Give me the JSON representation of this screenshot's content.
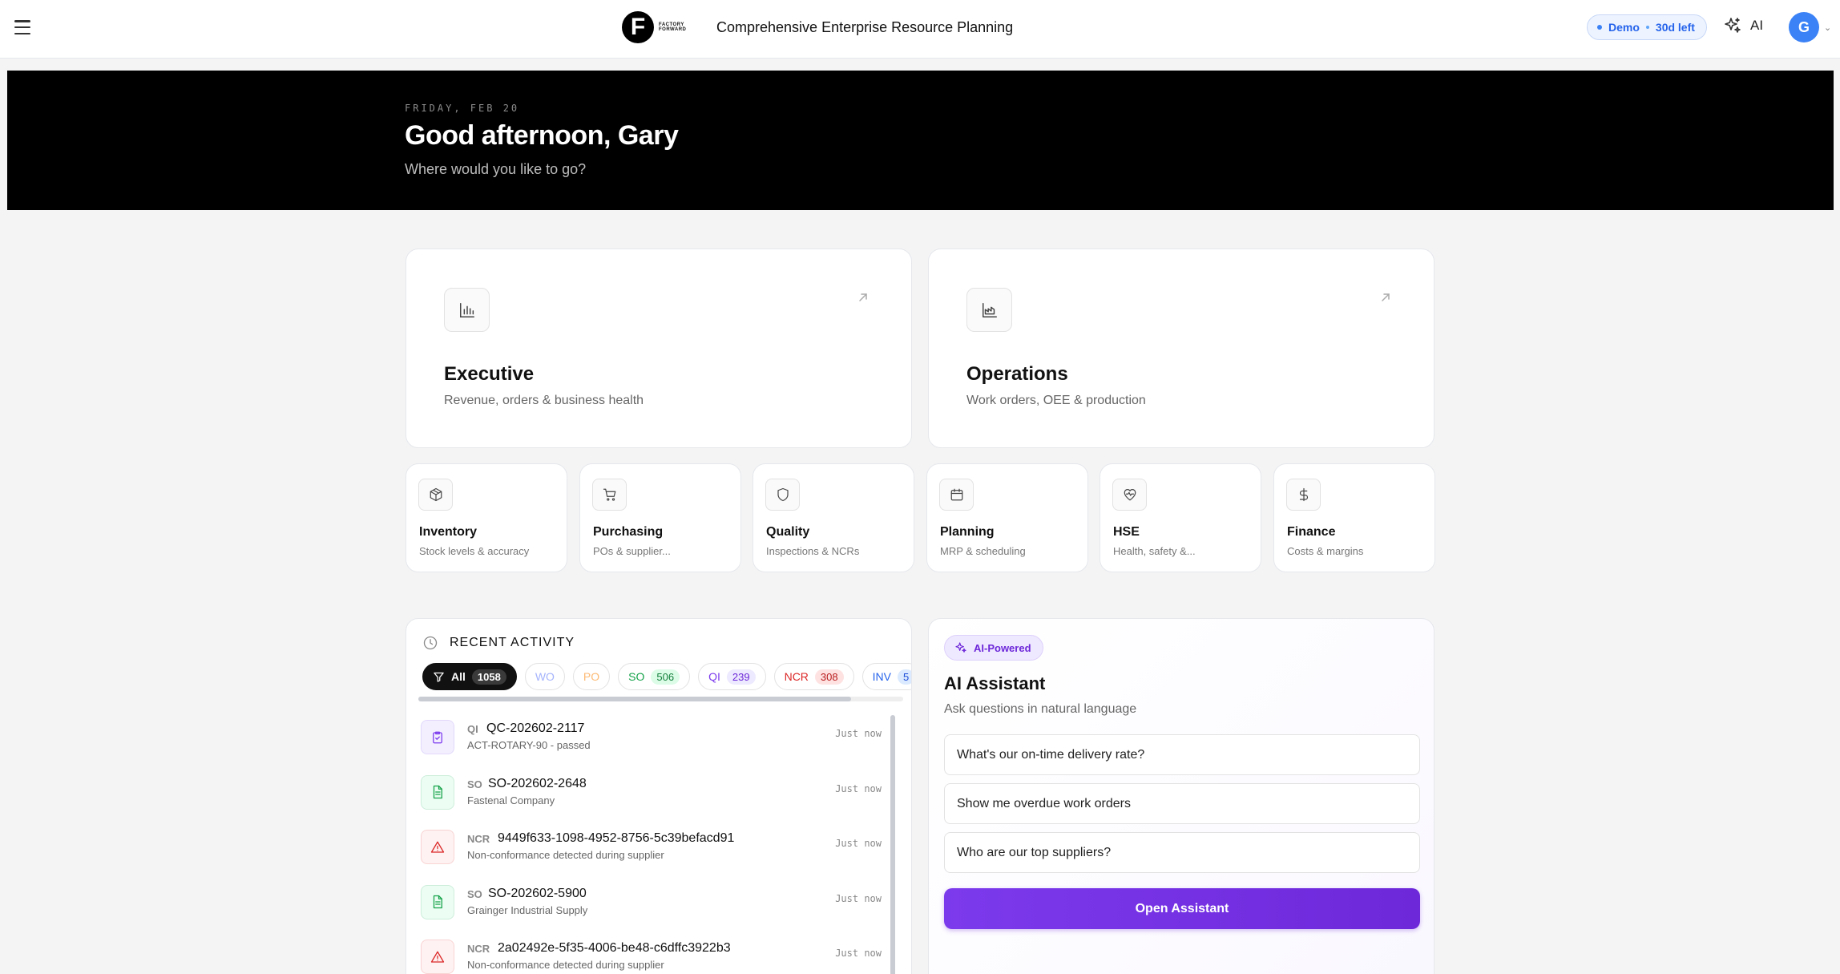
{
  "header": {
    "brand_mark": "F",
    "brand_wordmark": "FACTORY FORWARD",
    "app_title": "Comprehensive Enterprise Resource Planning",
    "demo_label": "Demo",
    "demo_remaining": "30d left",
    "ai_label": "AI",
    "avatar_initial": "G"
  },
  "hero": {
    "date": "FRIDAY, FEB 20",
    "greeting": "Good afternoon, Gary",
    "subtitle": "Where would you like to go?"
  },
  "dashboards": [
    {
      "title": "Executive",
      "desc": "Revenue, orders & business health",
      "icon": "bar-chart-icon"
    },
    {
      "title": "Operations",
      "desc": "Work orders, OEE & production",
      "icon": "factory-icon"
    }
  ],
  "modules": [
    {
      "title": "Inventory",
      "desc": "Stock levels & accuracy",
      "icon": "package-icon"
    },
    {
      "title": "Purchasing",
      "desc": "POs & supplier...",
      "icon": "cart-icon"
    },
    {
      "title": "Quality",
      "desc": "Inspections & NCRs",
      "icon": "shield-icon"
    },
    {
      "title": "Planning",
      "desc": "MRP & scheduling",
      "icon": "calendar-icon"
    },
    {
      "title": "HSE",
      "desc": "Health, safety &...",
      "icon": "heart-pulse-icon"
    },
    {
      "title": "Finance",
      "desc": "Costs & margins",
      "icon": "dollar-icon"
    }
  ],
  "activity": {
    "heading": "RECENT ACTIVITY",
    "filters": [
      {
        "label": "All",
        "count": "1058",
        "color": "#111111"
      },
      {
        "label": "WO",
        "count": "",
        "color": "#a5b4fc"
      },
      {
        "label": "PO",
        "count": "",
        "color": "#fdba74"
      },
      {
        "label": "SO",
        "count": "506",
        "color": "#16a34a"
      },
      {
        "label": "QI",
        "count": "239",
        "color": "#7c3aed"
      },
      {
        "label": "NCR",
        "count": "308",
        "color": "#dc2626"
      },
      {
        "label": "INV",
        "count": "5",
        "color": "#2563eb"
      }
    ],
    "items": [
      {
        "type": "QI",
        "id": "QC-202602-2117",
        "sub": "ACT-ROTARY-90 - passed",
        "time": "Just now",
        "icon": "clipboard-check-icon"
      },
      {
        "type": "SO",
        "id": "SO-202602-2648",
        "sub": "Fastenal Company",
        "time": "Just now",
        "icon": "document-icon"
      },
      {
        "type": "NCR",
        "id": "9449f633-1098-4952-8756-5c39befacd91",
        "sub": "Non-conformance detected during supplier",
        "time": "Just now",
        "icon": "warning-icon"
      },
      {
        "type": "SO",
        "id": "SO-202602-5900",
        "sub": "Grainger Industrial Supply",
        "time": "Just now",
        "icon": "document-icon"
      },
      {
        "type": "NCR",
        "id": "2a02492e-5f35-4006-be48-c6dffc3922b3",
        "sub": "Non-conformance detected during supplier",
        "time": "Just now",
        "icon": "warning-icon"
      }
    ]
  },
  "assistant": {
    "badge": "AI-Powered",
    "title": "AI Assistant",
    "subtitle": "Ask questions in natural language",
    "suggestions": [
      "What's our on-time delivery rate?",
      "Show me overdue work orders",
      "Who are our top suppliers?"
    ],
    "button": "Open Assistant"
  },
  "colors": {
    "accent_purple": "#7c3aed",
    "demo_blue": "#2563eb",
    "so_green": "#16a34a",
    "ncr_red": "#dc2626",
    "qi_purple": "#7c3aed"
  }
}
